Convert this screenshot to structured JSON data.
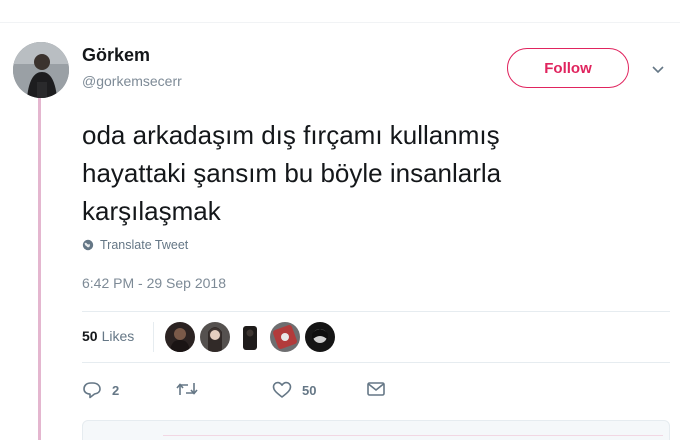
{
  "user": {
    "display_name": "Görkem",
    "handle": "@gorkemsecerr",
    "avatar_icon": "profile-photo"
  },
  "follow_button": {
    "label": "Follow"
  },
  "menu": {
    "icon": "chevron-down-icon"
  },
  "tweet": {
    "text": "oda arkadaşım dış fırçamı kullanmış\nhayattaki şansım bu böyle insanlarla\nkarşılaşmak",
    "translate_label": "Translate Tweet",
    "timestamp": "6:42 PM - 29 Sep 2018"
  },
  "stats": {
    "likes_count": "50",
    "likes_label": "Likes",
    "liker_avatar_count": 5
  },
  "actions": {
    "reply_count": "2",
    "retweet_count": "",
    "like_count": "50",
    "message_count": ""
  },
  "colors": {
    "accent": "#e0245e",
    "thread_line": "#e4b6cf",
    "muted_text": "#657786",
    "primary_text": "#14171a"
  }
}
